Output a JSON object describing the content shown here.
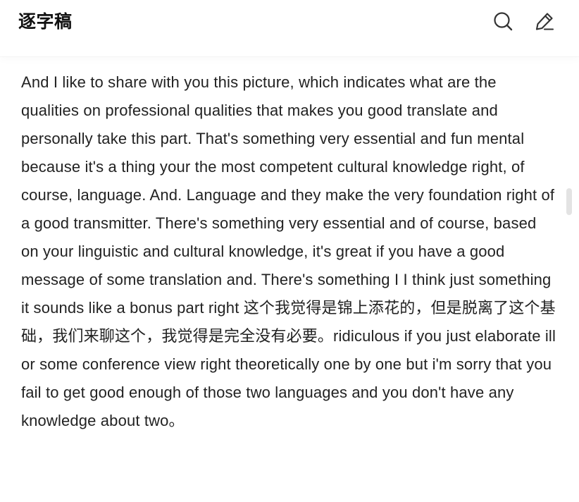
{
  "header": {
    "title": "逐字稿",
    "icons": [
      "search-icon",
      "edit-icon"
    ]
  },
  "transcript": {
    "text": "And I like to share with you this picture, which indicates what are the qualities on professional qualities that makes you good translate and personally take this part. That's something very essential and fun mental because it's a thing your the most competent cultural knowledge right, of course, language. And. Language and they make the very foundation right of a good transmitter. There's something very essential and of course, based on your linguistic and cultural knowledge, it's great if you have a good message of some translation and. There's something I I think just something it sounds like a bonus part right 这个我觉得是锦上添花的，但是脱离了这个基础，我们来聊这个，我觉得是完全没有必要。ridiculous if you just elaborate ill or some conference view right theoretically one by one but i'm sorry that you fail to get good enough of those two languages and you don't have any knowledge about two。"
  },
  "colors": {
    "text": "#222222",
    "title": "#111111",
    "icon": "#333333",
    "scrollbar": "#e3e3e3",
    "background": "#ffffff"
  }
}
